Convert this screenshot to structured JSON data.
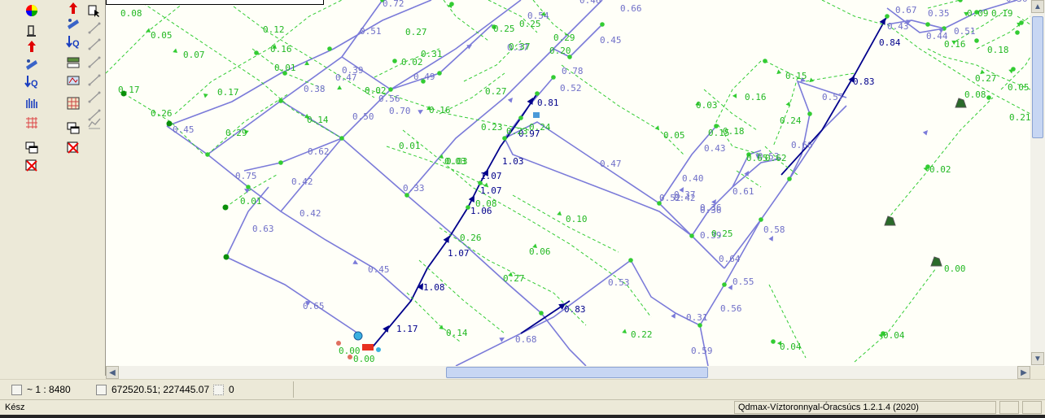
{
  "status": {
    "scale": "~ 1 : 8480",
    "coordinates": "672520.51; 227445.07",
    "selection_count": "0",
    "ready": "Kész",
    "app_title": "Qdmax-Víztoronnyal-Óracsúcs 1.2.1.4 (2020)"
  },
  "colors": {
    "main_pipe": "#00008b",
    "pipe": "#7b7bd9",
    "service_line": "#33cc33",
    "background": "#fffff8",
    "toolbar": "#ece9d8"
  },
  "toolbar_icons": {
    "left_column": [
      "color-wheel-icon",
      "hydrant-icon",
      "pump-icon",
      "pipe-flow-icon",
      "flow-q-icon",
      "bar-chart-icon",
      "grid-icon",
      "windows-icon",
      "close-windows-icon"
    ],
    "middle_column": [
      "pump-icon",
      "pipe-flow-icon",
      "flow-q-icon",
      "layers-icon",
      "layers-edit-icon",
      "grid-color-icon",
      "windows-icon",
      "close-windows-icon"
    ],
    "right_column": [
      "select-arrow-icon",
      "line-tool-icon",
      "line-tool-icon",
      "line-tool-icon",
      "line-tool-icon",
      "line-tool-icon",
      "line-tool-icon",
      "profile-icon"
    ]
  },
  "map_labels": {
    "main_pipe_labels": [
      "1.17",
      "1.08",
      "1.07",
      "1.06",
      "1.07",
      "1.07",
      "1.03",
      "0.97",
      "0.81",
      "0.83",
      "0.84",
      "0.83"
    ],
    "pipe_labels": [
      "0.72",
      "0.51",
      "0.39",
      "0.47",
      "0.38",
      "0.50",
      "0.70",
      "0.49",
      "0.45",
      "0.62",
      "0.75",
      "0.42",
      "0.63",
      "0.42",
      "0.45",
      "0.65",
      "0.33",
      "0.37",
      "0.52",
      "0.78",
      "0.66",
      "0.45",
      "0.47",
      "0.40",
      "0.37",
      "0.43",
      "0.61",
      "0.58",
      "0.55",
      "0.56",
      "0.59",
      "0.31",
      "0.53",
      "0.68",
      "0.64",
      "0.52",
      "0.66",
      "0.36",
      "0.39",
      "0.57",
      "0.53",
      "0.35",
      "0.51",
      "0.44",
      "0.36",
      "0.43",
      "0.67",
      "0.46",
      "0.54",
      "0.56",
      "0.42",
      "0.36"
    ],
    "service_labels": [
      "0.08",
      "0.05",
      "0.07",
      "0.17",
      "0.26",
      "0.12",
      "0.16",
      "0.01",
      "0.17",
      "0.29",
      "0.14",
      "0.27",
      "0.02",
      "0.31",
      "0.25",
      "0.02",
      "0.25",
      "0.37",
      "0.29",
      "0.23",
      "0.20",
      "0.27",
      "0.16",
      "0.23",
      "0.24",
      "0.01",
      "0.03",
      "0.08",
      "0.10",
      "0.06",
      "0.27",
      "0.26",
      "0.14",
      "0.22",
      "0.03",
      "0.16",
      "0.18",
      "0.15",
      "0.24",
      "0.05",
      "0.25",
      "0.04",
      "0.04",
      "0.02",
      "0.00",
      "0.00",
      "0.27",
      "0.16",
      "0.18",
      "0.09",
      "0.19",
      "0.05",
      "0.21",
      "0.08",
      "0.01",
      "0.03",
      "0.15",
      "0.65",
      "0.62",
      "0.00"
    ]
  }
}
